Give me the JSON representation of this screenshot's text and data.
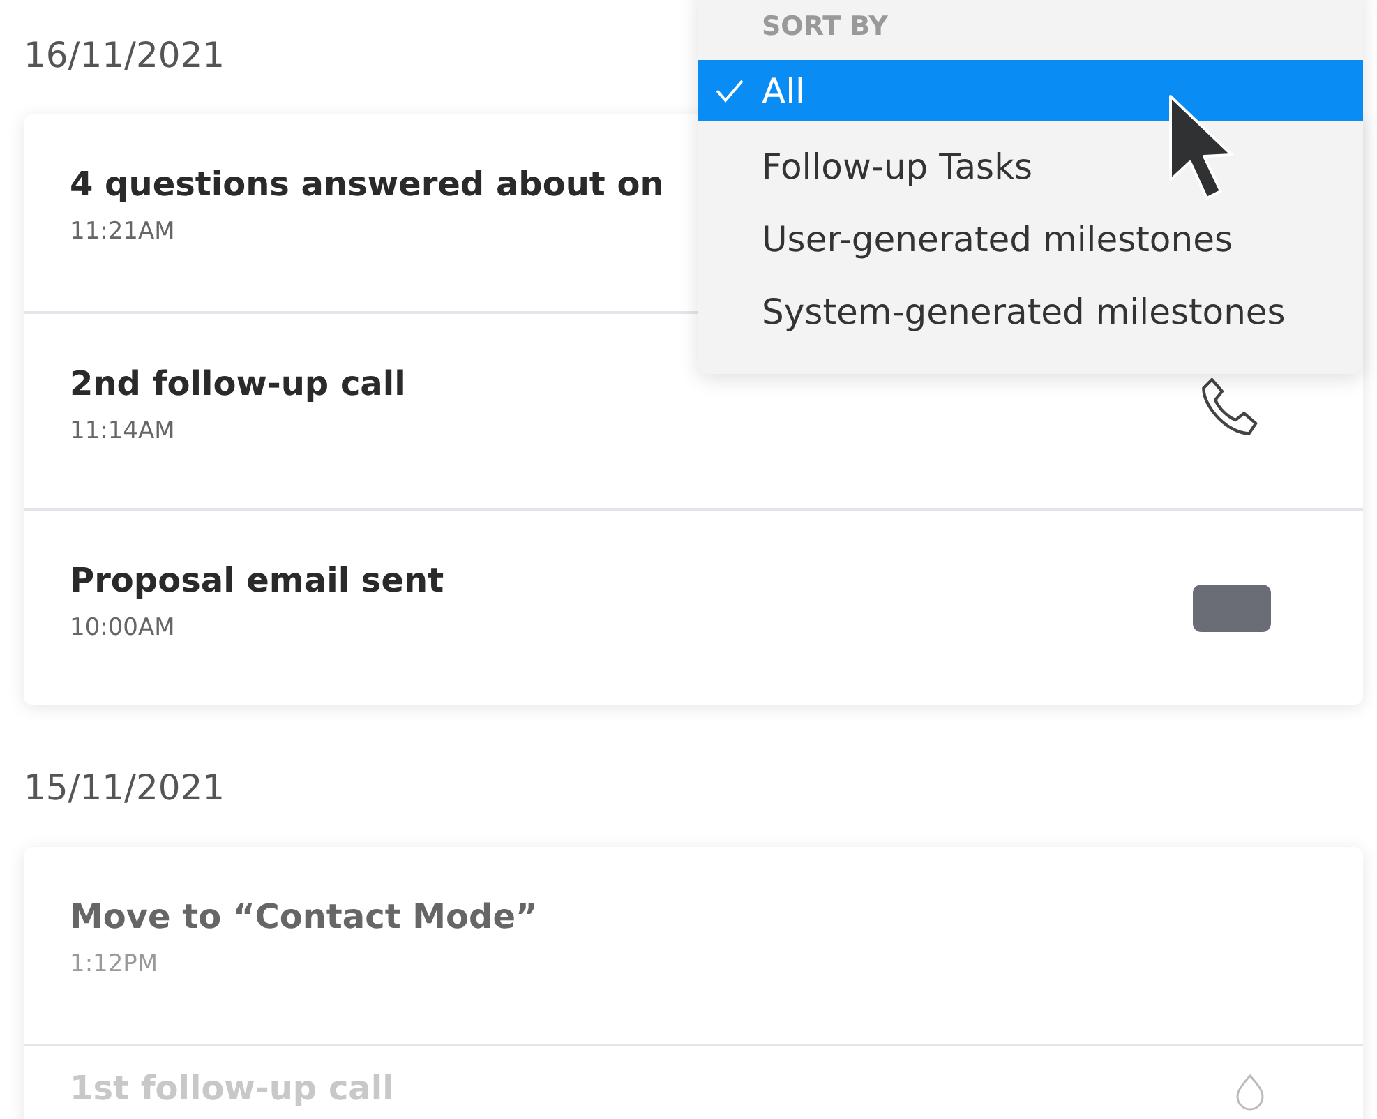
{
  "groups": [
    {
      "date": "16/11/2021",
      "rows": [
        {
          "title": "4 questions answered about on",
          "time": "11:21AM",
          "faded": false,
          "kind": "none"
        },
        {
          "title": "2nd follow-up call",
          "time": "11:14AM",
          "faded": false,
          "kind": "phone"
        },
        {
          "title": "Proposal email sent",
          "time": "10:00AM",
          "faded": false,
          "kind": "email"
        }
      ]
    },
    {
      "date": "15/11/2021",
      "rows": [
        {
          "title": "Move to “Contact Mode”",
          "time": "1:12PM",
          "faded": true,
          "kind": "none"
        },
        {
          "title": "1st follow-up call",
          "faded": true,
          "kind": "drop"
        }
      ]
    }
  ],
  "sort_menu": {
    "header": "SORT BY",
    "items": [
      {
        "label": "All",
        "selected": true
      },
      {
        "label": "Follow-up Tasks",
        "selected": false
      },
      {
        "label": "User-generated milestones",
        "selected": false
      },
      {
        "label": "System-generated milestones",
        "selected": false
      }
    ]
  }
}
